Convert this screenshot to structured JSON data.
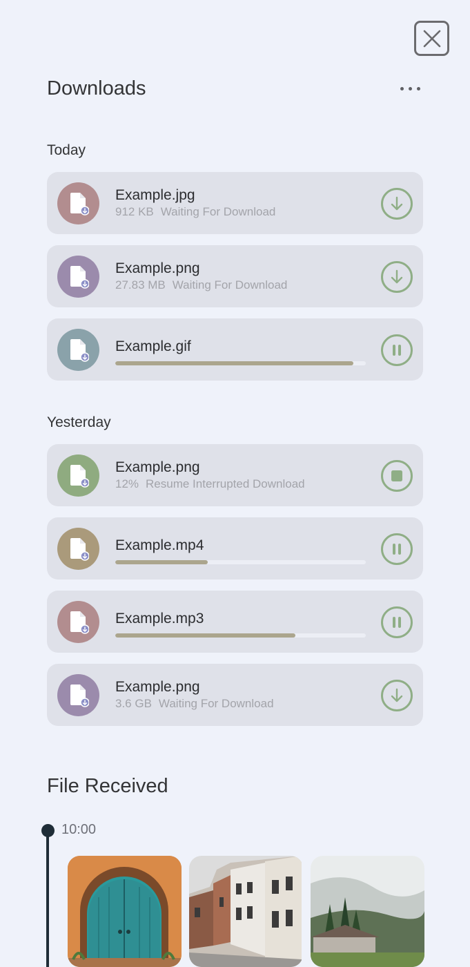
{
  "header": {
    "title": "Downloads",
    "close_icon": "close-icon",
    "more_icon": "more-horizontal-icon"
  },
  "sections": [
    {
      "title": "Today",
      "items": [
        {
          "name": "Example.jpg",
          "size": "912 KB",
          "status": "Waiting For Download",
          "avatar_color": "#b28d8f",
          "action": "download-icon"
        },
        {
          "name": "Example.png",
          "size": "27.83 MB",
          "status": "Waiting For Download",
          "avatar_color": "#9b8bac",
          "action": "download-icon"
        },
        {
          "name": "Example.gif",
          "progress": 0.95,
          "avatar_color": "#8aa2aa",
          "action": "pause-icon"
        }
      ]
    },
    {
      "title": "Yesterday",
      "items": [
        {
          "name": "Example.png",
          "size": "12%",
          "status": "Resume Interrupted Download",
          "avatar_color": "#8fab80",
          "action": "stop-icon"
        },
        {
          "name": "Example.mp4",
          "progress": 0.37,
          "avatar_color": "#aa9a7b",
          "action": "pause-icon"
        },
        {
          "name": "Example.mp3",
          "progress": 0.72,
          "avatar_color": "#b28d8f",
          "action": "pause-icon"
        },
        {
          "name": "Example.png",
          "size": "3.6 GB",
          "status": "Waiting For Download",
          "avatar_color": "#9b8bac",
          "action": "download-icon"
        }
      ]
    }
  ],
  "received": {
    "title": "File Received",
    "time": "10:00",
    "thumbnails": [
      {
        "icon": "door-photo"
      },
      {
        "icon": "street-photo"
      },
      {
        "icon": "landscape-photo"
      }
    ]
  },
  "colors": {
    "background": "#eff2fa",
    "card": "#dfe1e9",
    "accent_green": "#8fae86",
    "progress": "#aba58d",
    "file_badge": "#8b8fc7"
  }
}
